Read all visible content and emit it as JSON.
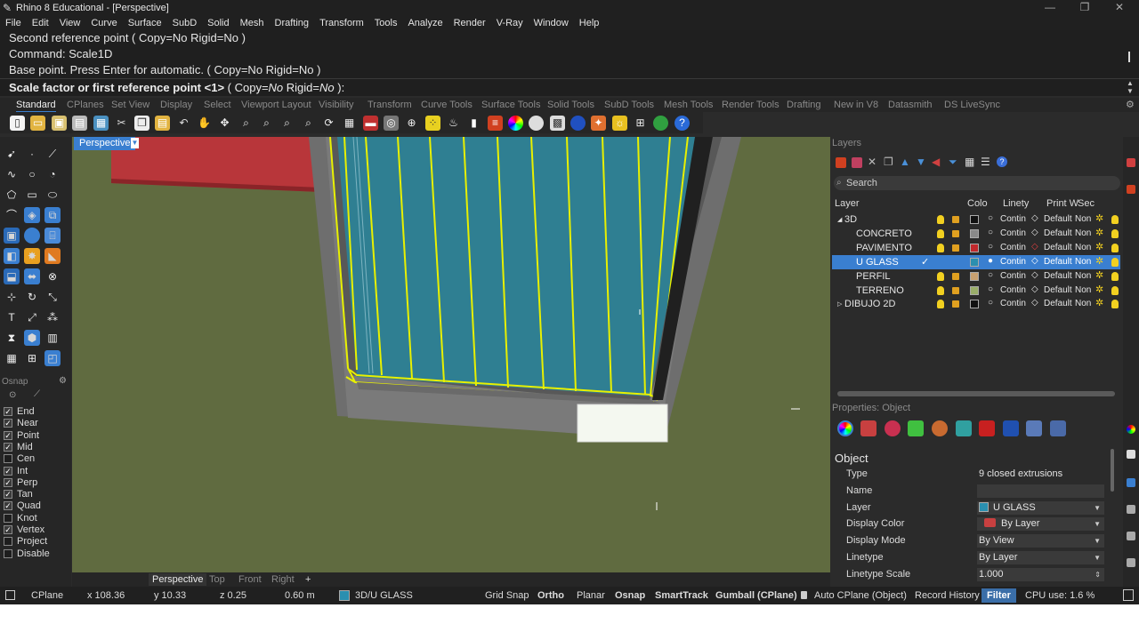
{
  "window": {
    "title": "Rhino 8 Educational - [Perspective]"
  },
  "menu": [
    "File",
    "Edit",
    "View",
    "Curve",
    "Surface",
    "SubD",
    "Solid",
    "Mesh",
    "Drafting",
    "Transform",
    "Tools",
    "Analyze",
    "Render",
    "V-Ray",
    "Window",
    "Help"
  ],
  "command_history": [
    "Second reference point ( Copy=No  Rigid=No )",
    "Command: Scale1D",
    "Base point. Press Enter for automatic. ( Copy=No  Rigid=No )"
  ],
  "command_prompt": {
    "main": "Scale factor or first reference point <1>",
    "opt_open": " ( Copy=",
    "copy_val": "No",
    "rigid_label": "  Rigid=",
    "rigid_val": "No",
    "close": " ):"
  },
  "toolbar_tabs": [
    "Standard",
    "CPlanes",
    "Set View",
    "Display",
    "Select",
    "Viewport Layout",
    "Visibility",
    "Transform",
    "Curve Tools",
    "Surface Tools",
    "Solid Tools",
    "SubD Tools",
    "Mesh Tools",
    "Render Tools",
    "Drafting",
    "New in V8",
    "Datasmith",
    "DS LiveSync"
  ],
  "viewport": {
    "label": "Perspective"
  },
  "viewport_tabs": [
    "Perspective",
    "Top",
    "Front",
    "Right"
  ],
  "osnap": {
    "title": "Osnap",
    "items": [
      {
        "label": "End",
        "checked": true
      },
      {
        "label": "Near",
        "checked": true
      },
      {
        "label": "Point",
        "checked": true
      },
      {
        "label": "Mid",
        "checked": true
      },
      {
        "label": "Cen",
        "checked": false
      },
      {
        "label": "Int",
        "checked": true
      },
      {
        "label": "Perp",
        "checked": true
      },
      {
        "label": "Tan",
        "checked": true
      },
      {
        "label": "Quad",
        "checked": true
      },
      {
        "label": "Knot",
        "checked": false
      },
      {
        "label": "Vertex",
        "checked": true
      },
      {
        "label": "Project",
        "checked": false
      },
      {
        "label": "Disable",
        "checked": false
      }
    ]
  },
  "layers": {
    "title": "Layers",
    "search_placeholder": "Search",
    "columns": {
      "layer": "Layer",
      "color": "Colo",
      "linetype": "Linety",
      "print": "Print W",
      "sec": "Sec"
    },
    "rows": [
      {
        "name": "3D",
        "indent": 0,
        "expander": "◢",
        "color": "#111111",
        "linetype": "Contin",
        "print": "Default",
        "sec": "Non",
        "selected": false
      },
      {
        "name": "CONCRETO",
        "indent": 1,
        "expander": "",
        "color": "#8a8a8a",
        "linetype": "Contin",
        "print": "Default",
        "sec": "Non",
        "selected": false
      },
      {
        "name": "PAVIMENTO",
        "indent": 1,
        "expander": "",
        "color": "#c0282c",
        "linetype": "Contin",
        "print": "Default",
        "sec": "Non",
        "selected": false
      },
      {
        "name": "U GLASS",
        "indent": 1,
        "expander": "",
        "color": "#2a8fb0",
        "linetype": "Contin",
        "print": "Default",
        "sec": "Non",
        "selected": true
      },
      {
        "name": "PERFIL",
        "indent": 1,
        "expander": "",
        "color": "#c8a070",
        "linetype": "Contin",
        "print": "Default",
        "sec": "Non",
        "selected": false
      },
      {
        "name": "TERRENO",
        "indent": 1,
        "expander": "",
        "color": "#9aae6a",
        "linetype": "Contin",
        "print": "Default",
        "sec": "Non",
        "selected": false
      },
      {
        "name": "DIBUJO 2D",
        "indent": 0,
        "expander": "▷",
        "color": "#111111",
        "linetype": "Contin",
        "print": "Default",
        "sec": "Non",
        "selected": false
      }
    ]
  },
  "properties": {
    "title": "Properties: Object",
    "section": "Object",
    "fields": [
      {
        "label": "Type",
        "value": "9 closed extrusions",
        "box": false,
        "dropdown": false
      },
      {
        "label": "Name",
        "value": "",
        "box": true,
        "dropdown": false
      },
      {
        "label": "Layer",
        "value": "U GLASS",
        "box": true,
        "dropdown": true
      },
      {
        "label": "Display Color",
        "value": "By Layer",
        "box": true,
        "dropdown": true
      },
      {
        "label": "Display Mode",
        "value": "By View",
        "box": true,
        "dropdown": true
      },
      {
        "label": "Linetype",
        "value": "By Layer",
        "box": true,
        "dropdown": true
      },
      {
        "label": "Linetype Scale",
        "value": "1.000",
        "box": true,
        "dropdown": false
      }
    ]
  },
  "status": {
    "cplane": "CPlane",
    "x": "x 108.36",
    "y": "y 10.33",
    "z": "z 0.25",
    "units": "0.60 m",
    "layer": "3D/U GLASS",
    "grid_snap": "Grid Snap",
    "ortho": "Ortho",
    "planar": "Planar",
    "osnap": "Osnap",
    "smarttrack": "SmartTrack",
    "gumball": "Gumball (CPlane)",
    "auto_cplane": "Auto CPlane (Object)",
    "record_history": "Record History",
    "filter": "Filter",
    "cpu": "CPU use: 1.6 %"
  },
  "colors": {
    "accent": "#3a7fd0",
    "glass": "#2f7f92",
    "highlight": "#e8f000",
    "ground": "#606b40"
  }
}
